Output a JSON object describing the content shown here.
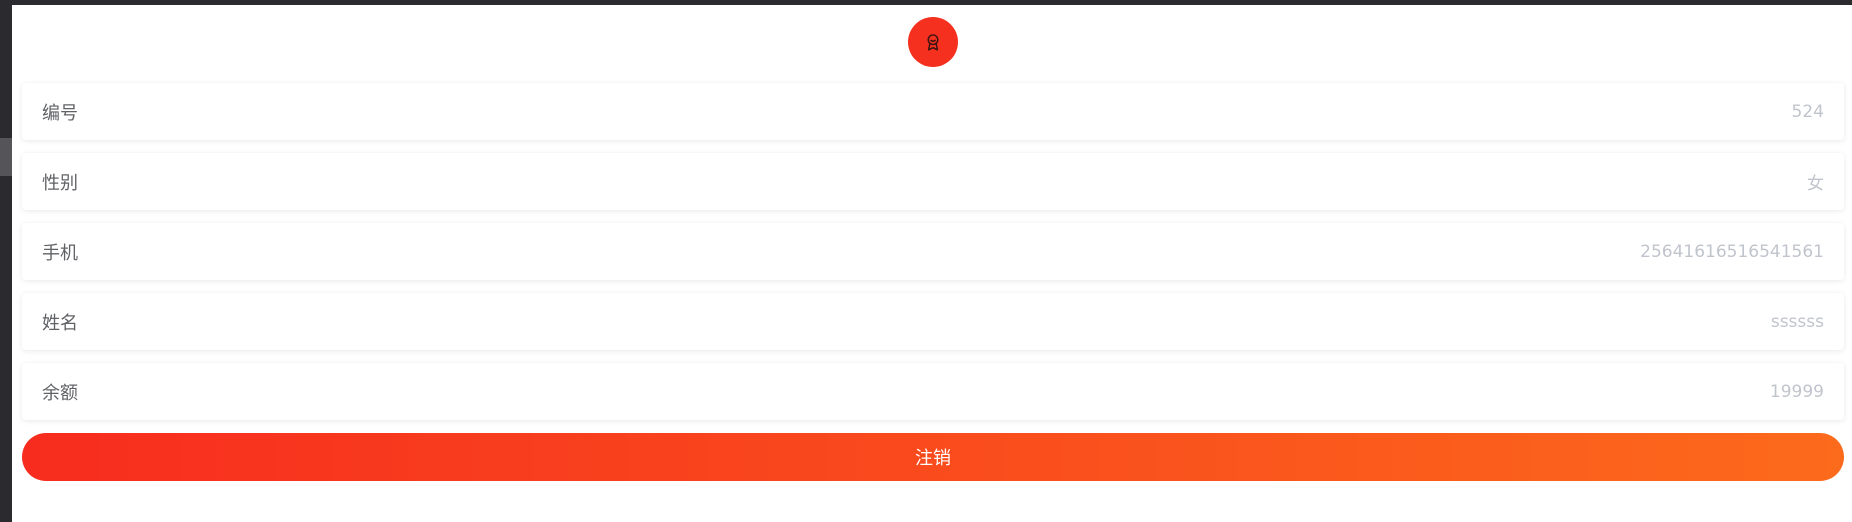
{
  "profile": {
    "avatar_icon": "badge-icon",
    "avatar_color": "#f5301e"
  },
  "fields": [
    {
      "label": "编号",
      "value": "524"
    },
    {
      "label": "性别",
      "value": "女"
    },
    {
      "label": "手机",
      "value": "25641616516541561"
    },
    {
      "label": "姓名",
      "value": "ssssss"
    },
    {
      "label": "余额",
      "value": "19999"
    }
  ],
  "actions": {
    "logout_label": "注销"
  },
  "colors": {
    "accent_start": "#f72c1e",
    "accent_end": "#fc6a1c",
    "label_text": "#606266",
    "value_text": "#c0c4cc"
  }
}
